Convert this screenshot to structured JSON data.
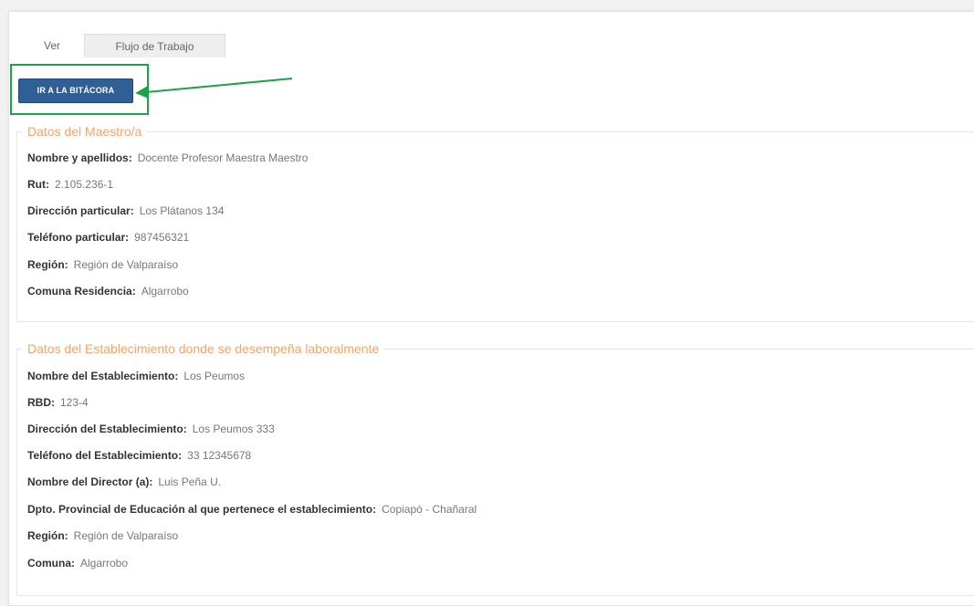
{
  "tabs": [
    {
      "label": "Ver"
    },
    {
      "label": "Flujo de Trabajo"
    }
  ],
  "actions": {
    "bitacora_label": "IR A LA BITÁCORA"
  },
  "colors": {
    "accent_button": "#2f5f95",
    "highlight_box": "#1aa34a",
    "section_title": "#f2a56a"
  },
  "sections": [
    {
      "title": "Datos del Maestro/a",
      "fields": [
        {
          "label": "Nombre y apellidos:",
          "value": "Docente Profesor Maestra Maestro"
        },
        {
          "label": "Rut:",
          "value": "2.105.236-1"
        },
        {
          "label": "Dirección particular:",
          "value": "Los Plátanos 134"
        },
        {
          "label": "Teléfono particular:",
          "value": "987456321"
        },
        {
          "label": "Región:",
          "value": "Región de Valparaíso"
        },
        {
          "label": "Comuna Residencia:",
          "value": "Algarrobo"
        }
      ]
    },
    {
      "title": "Datos del Establecimiento donde se desempeña laboralmente",
      "fields": [
        {
          "label": "Nombre del Establecimiento:",
          "value": "Los Peumos"
        },
        {
          "label": "RBD:",
          "value": "123-4"
        },
        {
          "label": "Dirección del Establecimiento:",
          "value": "Los Peumos 333"
        },
        {
          "label": "Teléfono del Establecimiento:",
          "value": "33 12345678"
        },
        {
          "label": "Nombre del Director (a):",
          "value": "Luis Peña U."
        },
        {
          "label": "Dpto. Provincial de Educación al que pertenece el establecimiento:",
          "value": "Copiapó - Chañaral"
        },
        {
          "label": "Región:",
          "value": "Región de Valparaíso"
        },
        {
          "label": "Comuna:",
          "value": "Algarrobo"
        }
      ]
    }
  ]
}
